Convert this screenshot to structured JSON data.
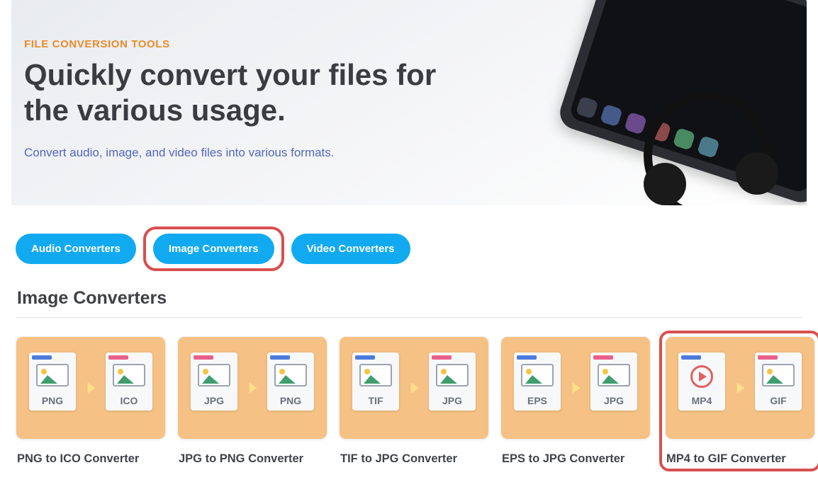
{
  "hero": {
    "eyebrow": "FILE CONVERSION TOOLS",
    "title": "Quickly convert your files for the various usage.",
    "subtitle": "Convert audio, image, and video files into various formats."
  },
  "tabs": [
    {
      "label": "Audio Converters",
      "highlight": false
    },
    {
      "label": "Image Converters",
      "highlight": true
    },
    {
      "label": "Video Converters",
      "highlight": false
    }
  ],
  "section": {
    "title": "Image Converters"
  },
  "cards": [
    {
      "from": "PNG",
      "to": "ICO",
      "title": "PNG to ICO Converter",
      "fromTab": "blue",
      "toTab": "pink",
      "media": false,
      "highlight": false
    },
    {
      "from": "JPG",
      "to": "PNG",
      "title": "JPG to PNG Converter",
      "fromTab": "pink",
      "toTab": "blue",
      "media": false,
      "highlight": false
    },
    {
      "from": "TIF",
      "to": "JPG",
      "title": "TIF to JPG Converter",
      "fromTab": "blue",
      "toTab": "pink",
      "media": false,
      "highlight": false
    },
    {
      "from": "EPS",
      "to": "JPG",
      "title": "EPS to JPG Converter",
      "fromTab": "blue",
      "toTab": "pink",
      "media": false,
      "highlight": false
    },
    {
      "from": "MP4",
      "to": "GIF",
      "title": "MP4 to GIF Converter",
      "fromTab": "blue",
      "toTab": "pink",
      "media": true,
      "highlight": true
    }
  ]
}
